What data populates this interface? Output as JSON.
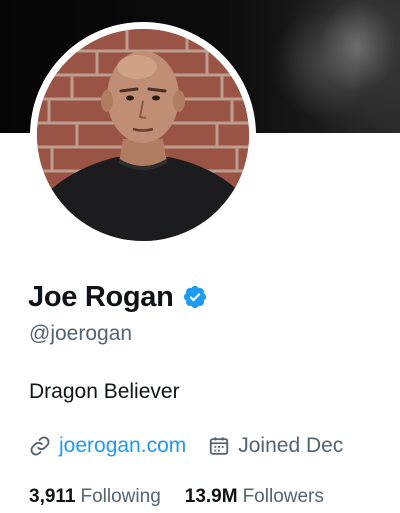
{
  "profile": {
    "display_name": "Joe Rogan",
    "handle": "@joerogan",
    "bio": "Dragon Believer",
    "website": "joerogan.com",
    "joined": "Joined Dec"
  },
  "stats": {
    "following_count": "3,911",
    "following_label": "Following",
    "followers_count": "13.9M",
    "followers_label": "Followers"
  },
  "icons": {
    "verified": "verified-badge-icon",
    "link": "link-icon",
    "calendar": "calendar-icon"
  },
  "colors": {
    "accent": "#1d9bf0",
    "text_primary": "#0f1419",
    "text_secondary": "#536471"
  }
}
